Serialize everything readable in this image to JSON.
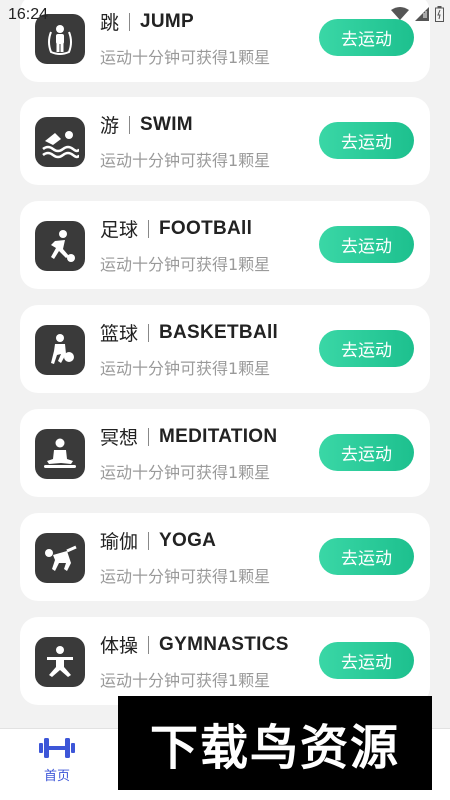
{
  "status_bar": {
    "time": "16:24"
  },
  "description": "运动十分钟可获得1颗星",
  "go_label": "去运动",
  "accent_color": "#1dc08e",
  "cards": [
    {
      "cn": "跳",
      "en": "JUMP",
      "icon": "jump-rope-icon"
    },
    {
      "cn": "游",
      "en": "SWIM",
      "icon": "swimming-icon"
    },
    {
      "cn": "足球",
      "en": "FOOTBAll",
      "icon": "football-icon"
    },
    {
      "cn": "篮球",
      "en": "BASKETBAll",
      "icon": "basketball-icon"
    },
    {
      "cn": "冥想",
      "en": "MEDITATION",
      "icon": "meditation-icon"
    },
    {
      "cn": "瑜伽",
      "en": "YOGA",
      "icon": "yoga-icon"
    },
    {
      "cn": "体操",
      "en": "GYMNASTICS",
      "icon": "gymnastics-icon"
    }
  ],
  "tab_bar": {
    "home_label": "首页",
    "home_icon": "dumbbell-icon"
  },
  "watermark": "下载鸟资源"
}
